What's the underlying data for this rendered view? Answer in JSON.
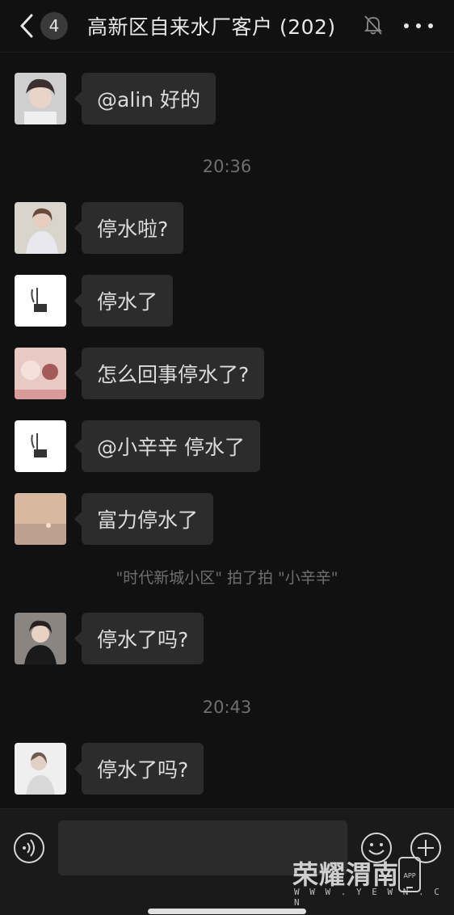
{
  "header": {
    "back_count": "4",
    "title": "高新区自来水厂客户 (202)"
  },
  "messages": [
    {
      "text": "@alin 好的"
    },
    {
      "text": "停水啦?"
    },
    {
      "text": "停水了"
    },
    {
      "text": "怎么回事停水了?"
    },
    {
      "text": "@小辛辛 停水了"
    },
    {
      "text": "富力停水了"
    },
    {
      "text": "停水了吗?"
    },
    {
      "text": "停水了吗?"
    }
  ],
  "timestamps": [
    "20:36",
    "20:43"
  ],
  "system_notice": "\"时代新城小区\" 拍了拍 \"小辛辛\"",
  "watermark": {
    "name": "荣耀渭南",
    "url": "W W W . Y E W N . C N",
    "app_label": "APP"
  },
  "colors": {
    "background": "#111111",
    "bubble": "#2c2c2c",
    "text": "#dcdcdc",
    "muted": "#6f6f6f"
  },
  "icons": [
    "back-chevron-icon",
    "mute-bell-icon",
    "more-icon",
    "voice-icon",
    "emoji-icon",
    "plus-icon",
    "app-phone-icon"
  ]
}
